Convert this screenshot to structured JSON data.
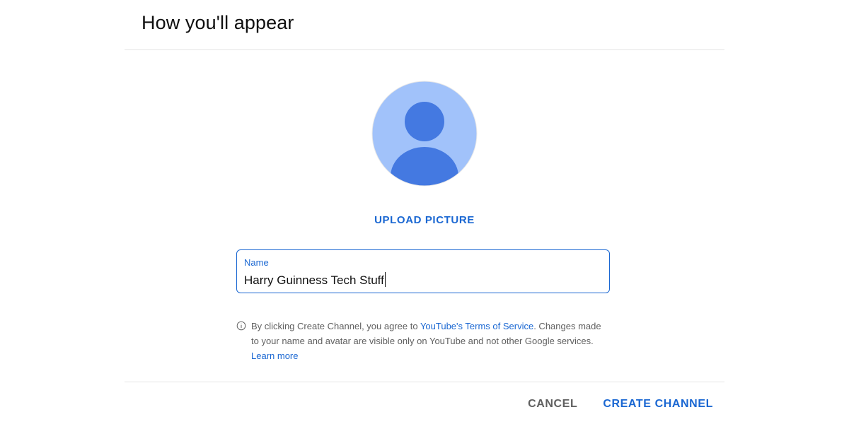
{
  "dialog": {
    "title": "How you'll appear",
    "upload_label": "UPLOAD PICTURE",
    "name_field": {
      "label": "Name",
      "value": "Harry Guinness Tech Stuff"
    },
    "notice": {
      "prefix": "By clicking Create Channel, you agree to ",
      "terms_link": "YouTube's Terms of Service",
      "middle": ". Changes made to your name and avatar are visible only on YouTube and not other Google services. ",
      "learn_more": "Learn more"
    },
    "actions": {
      "cancel_label": "CANCEL",
      "create_label": "CREATE CHANNEL"
    }
  },
  "icons": {
    "avatar": "default-person-avatar-icon",
    "info": "info-icon"
  },
  "colors": {
    "accent": "#1a67d2",
    "avatar_bg": "#a1c2fa",
    "avatar_fg": "#4479e1",
    "secondary_text": "#606060"
  }
}
